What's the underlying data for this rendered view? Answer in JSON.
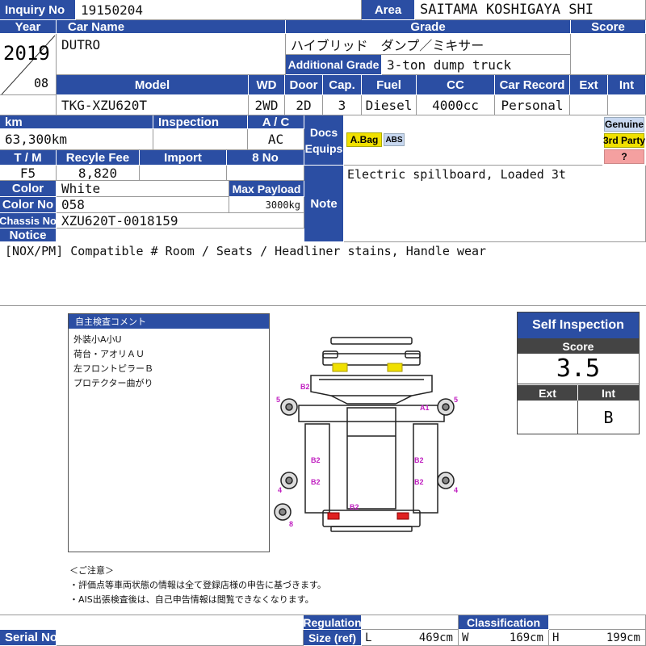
{
  "labels": {
    "inquiry_no": "Inquiry No",
    "area": "Area",
    "year": "Year",
    "car_name": "Car Name",
    "grade": "Grade",
    "score": "Score",
    "additional_grade": "Additional Grade",
    "model": "Model",
    "wd": "WD",
    "door": "Door",
    "cap": "Cap.",
    "fuel": "Fuel",
    "cc": "CC",
    "car_record": "Car Record",
    "ext": "Ext",
    "int": "Int",
    "km": "km",
    "inspection": "Inspection",
    "ac": "A / C",
    "docs_equips": "Docs Equips",
    "tm": "T / M",
    "recycle_fee": "Recyle Fee",
    "import": "Import",
    "no8": "8 No",
    "color": "Color",
    "max_payload": "Max Payload",
    "color_no": "Color No",
    "note": "Note",
    "chassis_no": "Chassis No",
    "notice": "Notice",
    "serial_no": "Serial No",
    "regulation": "Regulation",
    "classification": "Classification",
    "size_ref": "Size (ref)"
  },
  "vehicle": {
    "inquiry_no": "19150204",
    "area": "SAITAMA KOSHIGAYA SHI",
    "year": "2019",
    "month": "08",
    "car_name": "DUTRO",
    "grade": "ハイブリッド　ダンプ／ミキサー",
    "additional_grade": "3-ton dump truck",
    "model": "TKG-XZU620T",
    "wd": "2WD",
    "door": "2D",
    "cap": "3",
    "fuel": "Diesel",
    "cc": "4000cc",
    "car_record": "Personal",
    "km": "63,300km",
    "inspection": "",
    "ac": "AC",
    "tm": "F5",
    "recycle_fee": "8,820",
    "color": "White",
    "max_payload": "3000kg",
    "color_no": "058",
    "chassis_no": "XZU620T-0018159",
    "note": "Electric spillboard, Loaded 3t",
    "notice": "[NOX/PM] Compatible # Room / Seats / Headliner stains, Handle wear"
  },
  "equips": [
    "A.Bag",
    "ABS"
  ],
  "tags": {
    "genuine": "Genuine",
    "third_party": "3rd Party",
    "unknown": "?"
  },
  "inspection_comment": {
    "title": "自主検査コメント",
    "lines": [
      "外装小A小U",
      "荷台・アオリＡＵ",
      "左フロントピラーＢ",
      "プロテクター曲がり"
    ]
  },
  "diagram_marks": {
    "b2_top": "B2",
    "a1": "A1",
    "b2_left_1": "B2",
    "b2_left_2": "B2",
    "b2_right_1": "B2",
    "b2_right_2": "B2",
    "b2_bottom": "B2",
    "n5_left": "5",
    "n5_right": "5",
    "n4_left": "4",
    "n4_right": "4",
    "n8": "8"
  },
  "notes": {
    "heading": "＜ご注意＞",
    "line1": "・評価点等車両状態の情報は全て登録店様の申告に基づきます。",
    "line2": "・AIS出張検査後は、自己申告情報は閲覧できなくなります。"
  },
  "self_inspection": {
    "title": "Self Inspection",
    "score_label": "Score",
    "score": "3.5",
    "ext_label": "Ext",
    "int_label": "Int",
    "ext": "",
    "int": "B"
  },
  "size": {
    "l_label": "L",
    "l": "469cm",
    "w_label": "W",
    "w": "169cm",
    "h_label": "H",
    "h": "199cm"
  },
  "colors": {
    "header": "#2b4ea3",
    "diagram_mark": "#c020c0",
    "genuine_bg": "#c8d8f0",
    "third_party_bg": "#f0e000",
    "unknown_bg": "#f4a0a0"
  }
}
